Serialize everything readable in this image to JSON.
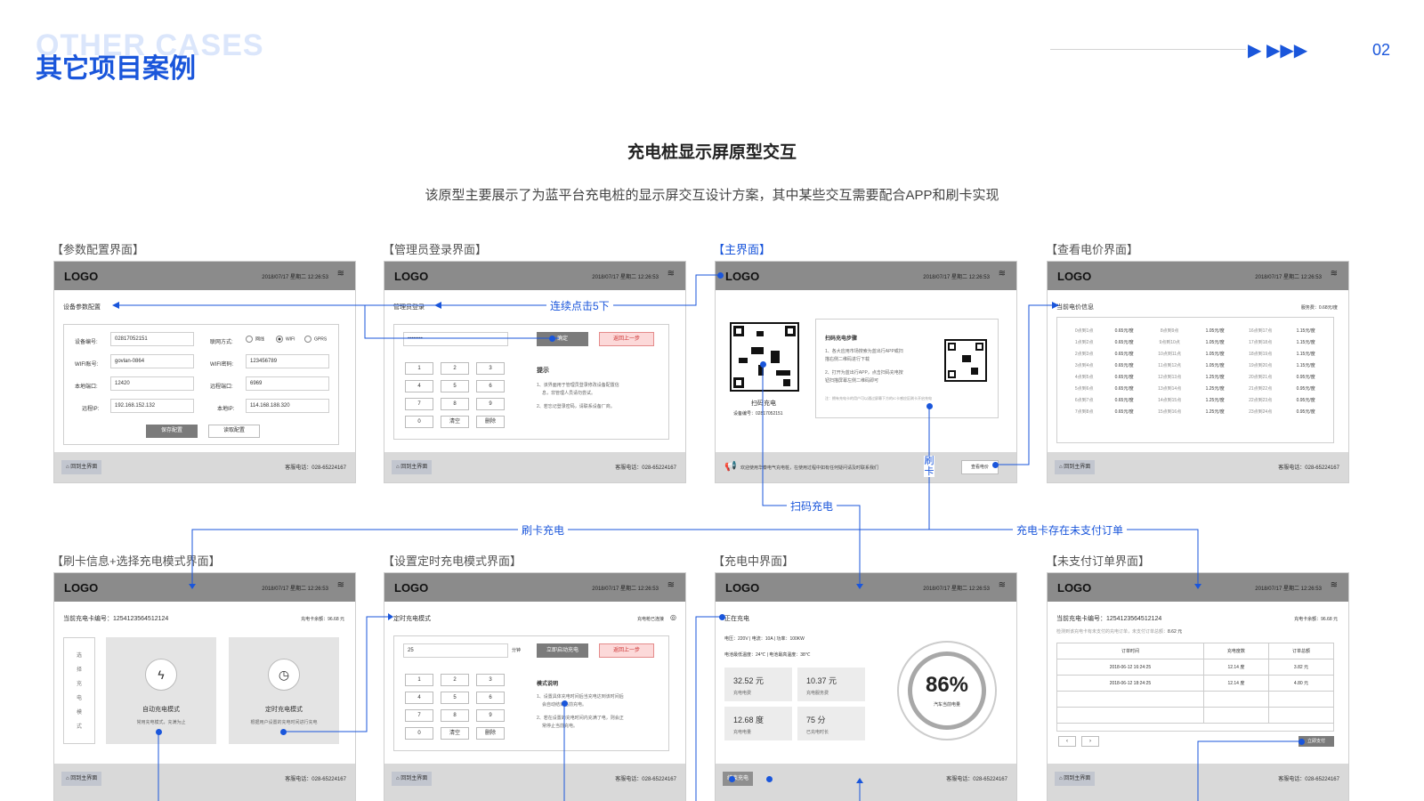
{
  "header": {
    "ghost_title": "OTHER CASES",
    "page_title": "其它项目案例",
    "arrows": "▶  ▶▶▶",
    "page_number": "02"
  },
  "section": {
    "title": "充电桩显示屏原型交互",
    "desc": "该原型主要展示了为蓝平台充电桩的显示屏交互设计方案，其中某些交互需要配合APP和刷卡实现"
  },
  "common": {
    "logo": "LOGO",
    "datetime": "2018/07/17 星期二 12:26:53",
    "wifi": "≋",
    "home": "回到主界面",
    "tel": "客服电话：028-65224167"
  },
  "screens": {
    "s1": {
      "label": "【参数配置界面】",
      "heading": "设备参数配置",
      "f_device_label": "设备编号:",
      "f_device": "02817052151",
      "f_wifi_label": "WIFI账号:",
      "f_wifi": "govlan-0864",
      "f_port_label": "本地端口:",
      "f_port": "12420",
      "f_rip_label": "远程IP:",
      "f_rip": "192.168.152.132",
      "f_net_label": "联网方式:",
      "r1": "网线",
      "r2": "WIFI",
      "r3": "GPRS",
      "f_pwd_label": "WIFI密码:",
      "f_pwd": "123456789",
      "f_rport_label": "远程端口:",
      "f_rport": "6969",
      "f_lip_label": "本地IP:",
      "f_lip": "114.168.188.320",
      "save": "保存配置",
      "read": "读取配置"
    },
    "s2": {
      "label": "【管理员登录界面】",
      "heading": "管理员登录",
      "pwd": "••••••••",
      "ok": "确定",
      "back": "返回上一步",
      "keys": [
        "1",
        "2",
        "3",
        "4",
        "5",
        "6",
        "7",
        "8",
        "9",
        "0",
        "清空",
        "删除"
      ],
      "tip_title": "提示",
      "tip1": "1、该界面用于管理员登录修改设备配置信",
      "tip1b": "息，非管理人员请勿尝试。",
      "tip2": "2、若忘记登录密码，请联系设备厂商。"
    },
    "s3": {
      "label": "【主界面】",
      "scan_label": "扫码充电",
      "device_no": "设备编号：02817052151",
      "steps_title": "扫码充电步骤",
      "step1": "1、各大应用市场搜索为蓝出行APP或扫",
      "step1b": "描右侧二维码进行下载",
      "step2": "2、打开为蓝出行APP，点击扫码充电按",
      "step2b": "钮扫描屏幕左侧二维码即可",
      "note": "注：拥有充电卡的用户可以通过屏幕下方的IC卡感应区刷卡开启充电",
      "notice": "欢迎使用华泰电气充电桩，在使用过程中如有任何疑问请及时联系我们",
      "price_btn": "查看电价",
      "swipe": "刷卡"
    },
    "s4": {
      "label": "【查看电价界面】",
      "heading": "当前电价信息",
      "service_fee": "服务费：0.68元/度",
      "rows": [
        [
          "0点到1点",
          "0.65元/度",
          "8点到9点",
          "1.05元/度",
          "16点到17点",
          "1.15元/度"
        ],
        [
          "1点到2点",
          "0.65元/度",
          "9点到10点",
          "1.05元/度",
          "17点到18点",
          "1.15元/度"
        ],
        [
          "2点到3点",
          "0.65元/度",
          "10点到11点",
          "1.05元/度",
          "18点到19点",
          "1.15元/度"
        ],
        [
          "3点到4点",
          "0.65元/度",
          "11点到12点",
          "1.05元/度",
          "19点到20点",
          "1.15元/度"
        ],
        [
          "4点到5点",
          "0.65元/度",
          "12点到13点",
          "1.25元/度",
          "20点到21点",
          "0.95元/度"
        ],
        [
          "5点到6点",
          "0.65元/度",
          "13点到14点",
          "1.25元/度",
          "21点到22点",
          "0.95元/度"
        ],
        [
          "6点到7点",
          "0.65元/度",
          "14点到15点",
          "1.25元/度",
          "22点到23点",
          "0.95元/度"
        ],
        [
          "7点到8点",
          "0.65元/度",
          "15点到16点",
          "1.25元/度",
          "23点到24点",
          "0.95元/度"
        ]
      ]
    },
    "s5": {
      "label": "【刷卡信息+选择充电模式界面】",
      "card_no": "当前充电卡编号：1254123564512124",
      "balance": "充电卡余额：96.68 元",
      "side": [
        "选",
        "择",
        "充",
        "电",
        "模",
        "式"
      ],
      "auto_title": "自动充电模式",
      "auto_desc": "常用充电模式，充满为止",
      "timer_title": "定时充电模式",
      "timer_desc": "根据用户设置的充电时间进行充电"
    },
    "s6": {
      "label": "【设置定时充电模式界面】",
      "heading": "定时充电模式",
      "status": "充电枪已连接",
      "minutes": "25",
      "unit": "分钟",
      "start": "立即启动充电",
      "back": "返回上一步",
      "keys": [
        "1",
        "2",
        "3",
        "4",
        "5",
        "6",
        "7",
        "8",
        "9",
        "0",
        "清空",
        "删除"
      ],
      "tip_title": "模式说明",
      "tip1": "1、设置具体充电时间后当充电达到该时间后",
      "tip1b": "会自动结束当前充电。",
      "tip2": "2、若在设置的充电时间内充满了电，则会正",
      "tip2b": "常停止当前充电。"
    },
    "s7": {
      "label": "【充电中界面】",
      "heading": "正在充电",
      "params": "电压：220V    |    电流：10A    |    功率：100KW",
      "temps": "电池最低温度：24℃    |    电池最高温度：38℃",
      "c1v": "32.52  元",
      "c1l": "充电电费",
      "c2v": "10.37  元",
      "c2l": "充电服务费",
      "c3v": "12.68  度",
      "c3l": "充电电量",
      "c4v": "75    分",
      "c4l": "已充电时长",
      "percent": "86%",
      "percent_label": "汽车当前电量",
      "stop": "结束充电"
    },
    "s8": {
      "label": "【未支付订单界面】",
      "card_no": "当前充电卡编号：1254123564512124",
      "balance": "充电卡余额：96.68 元",
      "warn": "检测到该充电卡有未支付的充电订单，未支付订单总额：",
      "warn_amt": "8.62 元",
      "cols": [
        "订单时间",
        "充电度数",
        "订单总额"
      ],
      "rows": [
        [
          "2018-06-12 16:24:25",
          "12.14 度",
          "3.82 元"
        ],
        [
          "2018-06-12 18:24:25",
          "12.14 度",
          "4.80 元"
        ]
      ],
      "prev": "‹",
      "next": "›",
      "pay": "立即支付"
    }
  },
  "annotations": {
    "click5": "连续点击5下",
    "scan_charge": "扫码充电",
    "swipe_charge": "刷卡充电",
    "unpaid": "充电卡存在未支付订单"
  },
  "colors": {
    "accent": "#1a56db",
    "bar": "#8b8b8b",
    "footer": "#d9d9d9"
  }
}
